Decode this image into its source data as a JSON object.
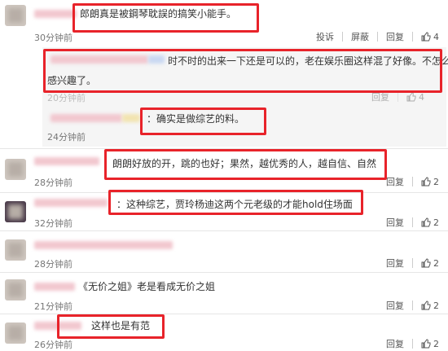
{
  "actions": {
    "report": "投诉",
    "block": "屏蔽",
    "reply": "回复",
    "like_count_4": "4",
    "like_count_2": "2"
  },
  "comments": [
    {
      "text": "郎朗真是被鋼琴耽誤的搞笑小能手。",
      "time": "30分钟前",
      "likes": "4"
    },
    {
      "text": "时不时的出来一下还是可以的，老在娱乐圈这样混了好像。不怎么",
      "text2": "感兴趣了。",
      "time": "20分钟前",
      "likes": "4"
    },
    {
      "text": "：确实是做综艺的料。",
      "time": "24分钟前"
    },
    {
      "text": "朗朗好放的开，跳的也好；果然，越优秀的人，越自信、自然",
      "time": "28分钟前",
      "likes": "2"
    },
    {
      "text": "：这种综艺，贾玲杨迪这两个元老级的才能hold住场面",
      "time": "32分钟前",
      "likes": "2"
    },
    {
      "text": "",
      "time": "28分钟前",
      "likes": "2"
    },
    {
      "text": "《无价之姐》老是看成无价之姐",
      "time": "21分钟前",
      "likes": "2"
    },
    {
      "text": "这样也是有范",
      "time": "26分钟前",
      "likes": "2"
    }
  ]
}
